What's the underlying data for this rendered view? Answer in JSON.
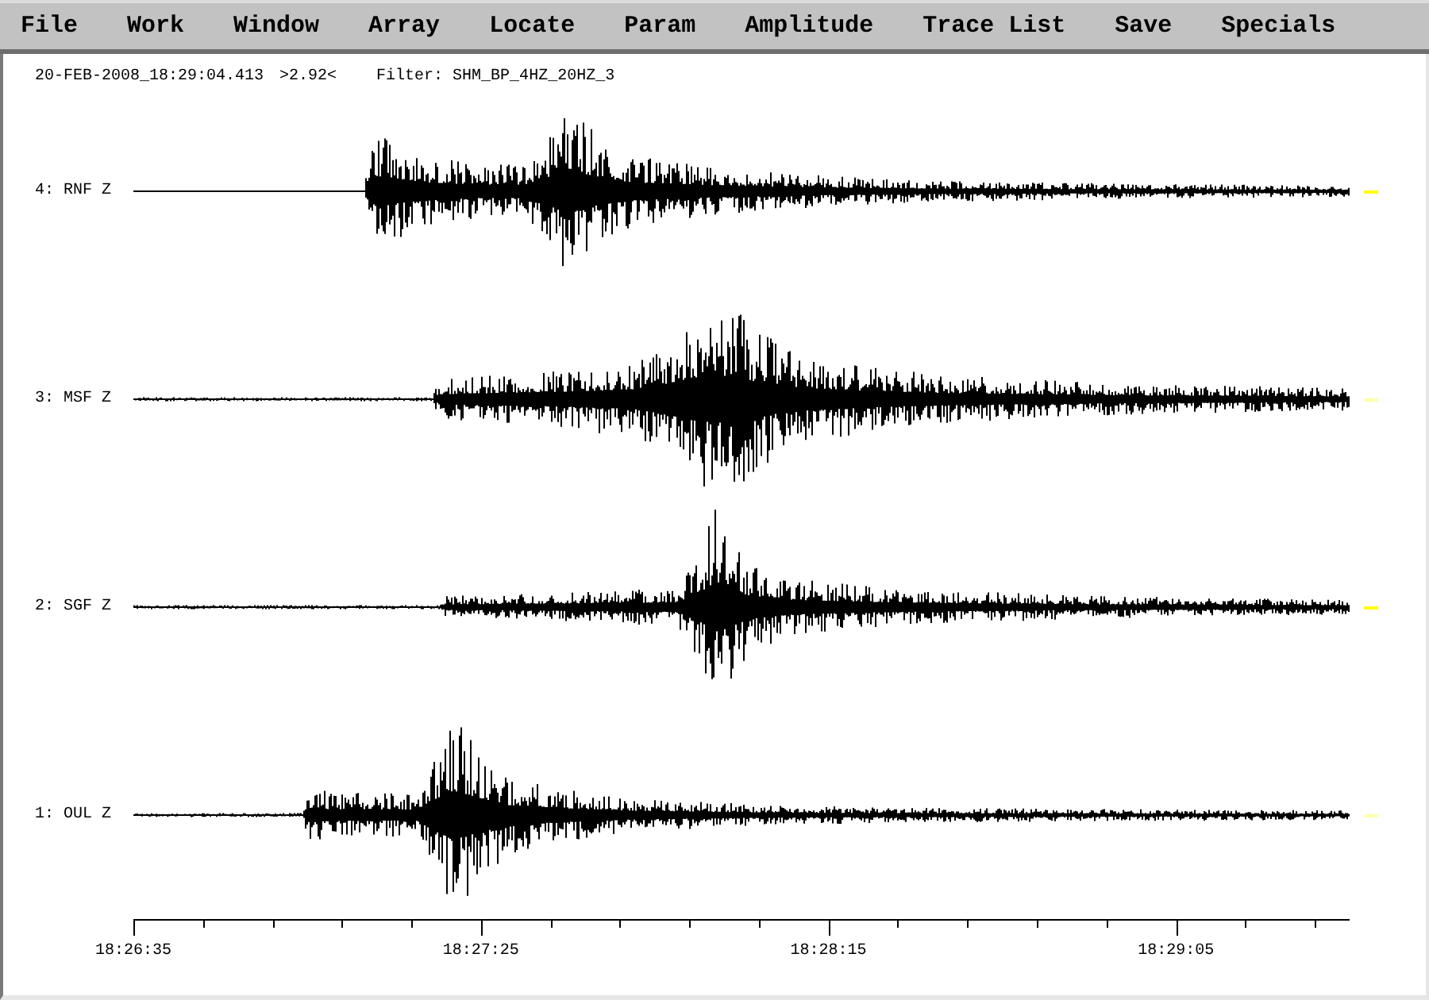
{
  "menu_bar": {
    "items": [
      "File",
      "Work",
      "Window",
      "Array",
      "Locate",
      "Param",
      "Amplitude",
      "Trace List",
      "Save",
      "Specials"
    ]
  },
  "header": {
    "timestamp": "20-FEB-2008_18:29:04.413",
    "value": ">2.92<",
    "filter": "Filter: SHM_BP_4HZ_20HZ_3"
  },
  "traces": [
    {
      "label": "4: RNF Z",
      "color": "#ffff00"
    },
    {
      "label": "3: MSF Z",
      "color": "#ffffa8"
    },
    {
      "label": "2: SGF Z",
      "color": "#ffff00"
    },
    {
      "label": "1: OUL Z",
      "color": "#ffffa8"
    }
  ],
  "time_axis": {
    "labels": [
      "18:26:35",
      "18:27:25",
      "18:28:15",
      "18:29:05"
    ]
  }
}
